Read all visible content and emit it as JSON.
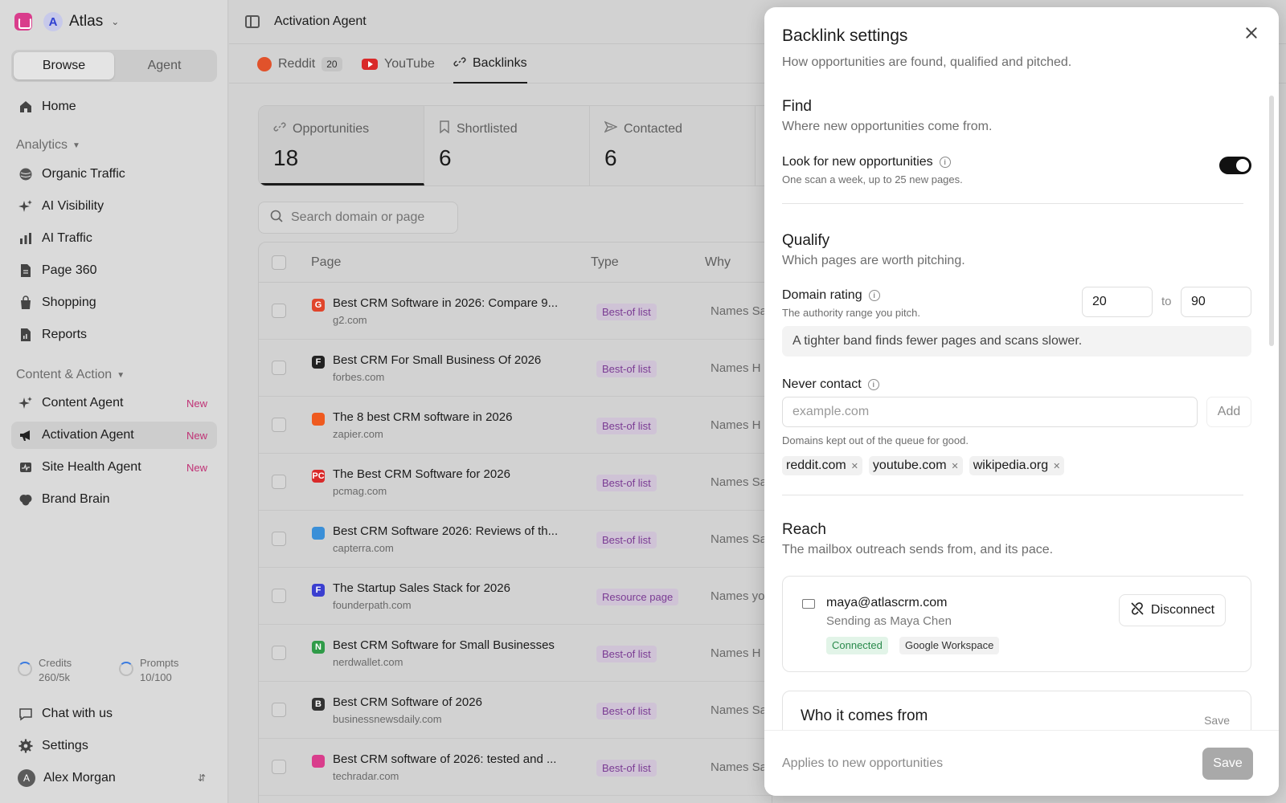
{
  "workspace": {
    "name": "Atlas",
    "initial": "A"
  },
  "sidebar": {
    "segments": [
      "Browse",
      "Agent"
    ],
    "home": "Home",
    "analytics_label": "Analytics",
    "analytics": [
      "Organic Traffic",
      "AI Visibility",
      "AI Traffic",
      "Page 360",
      "Shopping",
      "Reports"
    ],
    "content_label": "Content & Action",
    "content": [
      {
        "label": "Content Agent",
        "badge": "New"
      },
      {
        "label": "Activation Agent",
        "badge": "New"
      },
      {
        "label": "Site Health Agent",
        "badge": "New"
      },
      {
        "label": "Brand Brain",
        "badge": ""
      }
    ],
    "usage": [
      {
        "label": "Credits",
        "value": "260/5k"
      },
      {
        "label": "Prompts",
        "value": "10/100"
      }
    ],
    "chat": "Chat with us",
    "settings": "Settings",
    "user": {
      "name": "Alex Morgan",
      "initial": "A"
    }
  },
  "header": {
    "title": "Activation Agent"
  },
  "tabs": [
    {
      "label": "Reddit",
      "count": "20"
    },
    {
      "label": "YouTube",
      "count": ""
    },
    {
      "label": "Backlinks",
      "count": ""
    }
  ],
  "stats": [
    {
      "label": "Opportunities",
      "value": "18"
    },
    {
      "label": "Shortlisted",
      "value": "6"
    },
    {
      "label": "Contacted",
      "value": "6"
    }
  ],
  "search": {
    "placeholder": "Search domain or page"
  },
  "table": {
    "columns": [
      "Page",
      "Type",
      "Why"
    ],
    "rows": [
      {
        "title": "Best CRM Software in 2026: Compare 9...",
        "domain": "g2.com",
        "type": "Best-of list",
        "why": "Names Sa",
        "fav": "G",
        "color": "#e0452b"
      },
      {
        "title": "Best CRM For Small Business Of 2026",
        "domain": "forbes.com",
        "type": "Best-of list",
        "why": "Names H",
        "fav": "F",
        "color": "#222222"
      },
      {
        "title": "The 8 best CRM software in 2026",
        "domain": "zapier.com",
        "type": "Best-of list",
        "why": "Names H",
        "fav": "",
        "color": "#ef5a1f"
      },
      {
        "title": "The Best CRM Software for 2026",
        "domain": "pcmag.com",
        "type": "Best-of list",
        "why": "Names Sa",
        "fav": "PC",
        "color": "#d92a2a"
      },
      {
        "title": "Best CRM Software 2026: Reviews of th...",
        "domain": "capterra.com",
        "type": "Best-of list",
        "why": "Names Sa",
        "fav": "",
        "color": "#3a8fd8"
      },
      {
        "title": "The Startup Sales Stack for 2026",
        "domain": "founderpath.com",
        "type": "Resource page",
        "why": "Names yo",
        "fav": "F",
        "color": "#3b3fd0"
      },
      {
        "title": "Best CRM Software for Small Businesses",
        "domain": "nerdwallet.com",
        "type": "Best-of list",
        "why": "Names H",
        "fav": "N",
        "color": "#2f9b48"
      },
      {
        "title": "Best CRM Software of 2026",
        "domain": "businessnewsdaily.com",
        "type": "Best-of list",
        "why": "Names Sa",
        "fav": "B",
        "color": "#333333"
      },
      {
        "title": "Best CRM software of 2026: tested and ...",
        "domain": "techradar.com",
        "type": "Best-of list",
        "why": "Names Sa",
        "fav": "",
        "color": "#d93d8c"
      }
    ]
  },
  "drawer": {
    "title": "Backlink settings",
    "subtitle": "How opportunities are found, qualified and pitched.",
    "find": {
      "heading": "Find",
      "sub": "Where new opportunities come from.",
      "toggle_label": "Look for new opportunities",
      "toggle_hint": "One scan a week, up to 25 new pages.",
      "toggle_on": true
    },
    "qualify": {
      "heading": "Qualify",
      "sub": "Which pages are worth pitching.",
      "dr_label": "Domain rating",
      "dr_hint": "The authority range you pitch.",
      "dr_min": "20",
      "dr_to": "to",
      "dr_max": "90",
      "note": "A tighter band finds fewer pages and scans slower.",
      "never_label": "Never contact",
      "never_placeholder": "example.com",
      "add_label": "Add",
      "never_hint": "Domains kept out of the queue for good.",
      "blocked": [
        "reddit.com",
        "youtube.com",
        "wikipedia.org"
      ]
    },
    "reach": {
      "heading": "Reach",
      "sub": "The mailbox outreach sends from, and its pace.",
      "email": "maya@atlascrm.com",
      "sending_as": "Sending as Maya Chen",
      "status": "Connected",
      "provider": "Google Workspace",
      "disconnect": "Disconnect"
    },
    "who": {
      "heading": "Who it comes from",
      "save": "Save"
    },
    "footer": {
      "applies": "Applies to new opportunities",
      "save": "Save"
    }
  },
  "icons": [
    "reddit-icon",
    "youtube-icon",
    "link-icon",
    "search-icon",
    "close-icon",
    "mail-icon",
    "unlink-icon",
    "info-icon"
  ]
}
